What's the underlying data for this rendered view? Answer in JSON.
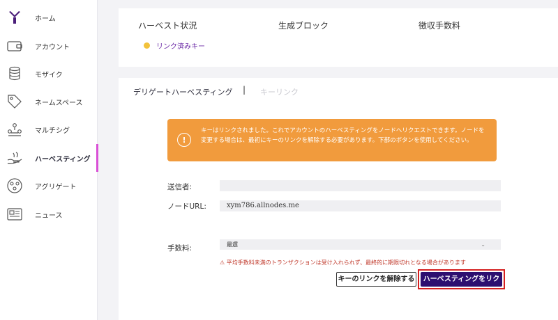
{
  "sidebar": {
    "items": [
      {
        "label": "ホーム",
        "icon": "home-logo-icon"
      },
      {
        "label": "アカウント",
        "icon": "wallet-icon"
      },
      {
        "label": "モザイク",
        "icon": "coins-stack-icon"
      },
      {
        "label": "ネームスペース",
        "icon": "tag-icon"
      },
      {
        "label": "マルチシグ",
        "icon": "multisig-users-icon"
      },
      {
        "label": "ハーベスティング",
        "icon": "harvest-hand-icon"
      },
      {
        "label": "アグリゲート",
        "icon": "aggregate-icon"
      },
      {
        "label": "ニュース",
        "icon": "news-icon"
      }
    ],
    "active_index": 5,
    "accent_color": "#d94fd6"
  },
  "summary": {
    "harvest_status_header": "ハーベスト状況",
    "blocks_header": "生成ブロック",
    "fees_header": "徴収手数料",
    "status_text": "リンク済みキー",
    "status_color": "#f2c23b"
  },
  "tabs": {
    "delegated": "デリゲートハーベスティング",
    "separator": "|",
    "key_link": "キーリンク"
  },
  "alert": {
    "icon": "info-icon",
    "message": "キーはリンクされました。これでアカウントのハーベスティングをノードへリクエストできます。ノードを変更する場合は、最初にキーのリンクを解除する必要があります。下部のボタンを使用してください。",
    "color": "#f19b3d"
  },
  "form": {
    "sender_label": "送信者:",
    "sender_value": "",
    "node_url_label": "ノードURL:",
    "node_url_value": "xym786.allnodes.me",
    "fee_label": "手数料:",
    "fee_selected": "最遅",
    "fee_warning": "⚠ 平均手数料未満のトランザクションは受け入れられず、最終的に期限切れとなる場合があります"
  },
  "buttons": {
    "unlink_label": "キーのリンクを解除する",
    "request_label": "ハーベスティングをリク",
    "request_color": "#2d0f70",
    "highlight_color": "#d42020"
  }
}
